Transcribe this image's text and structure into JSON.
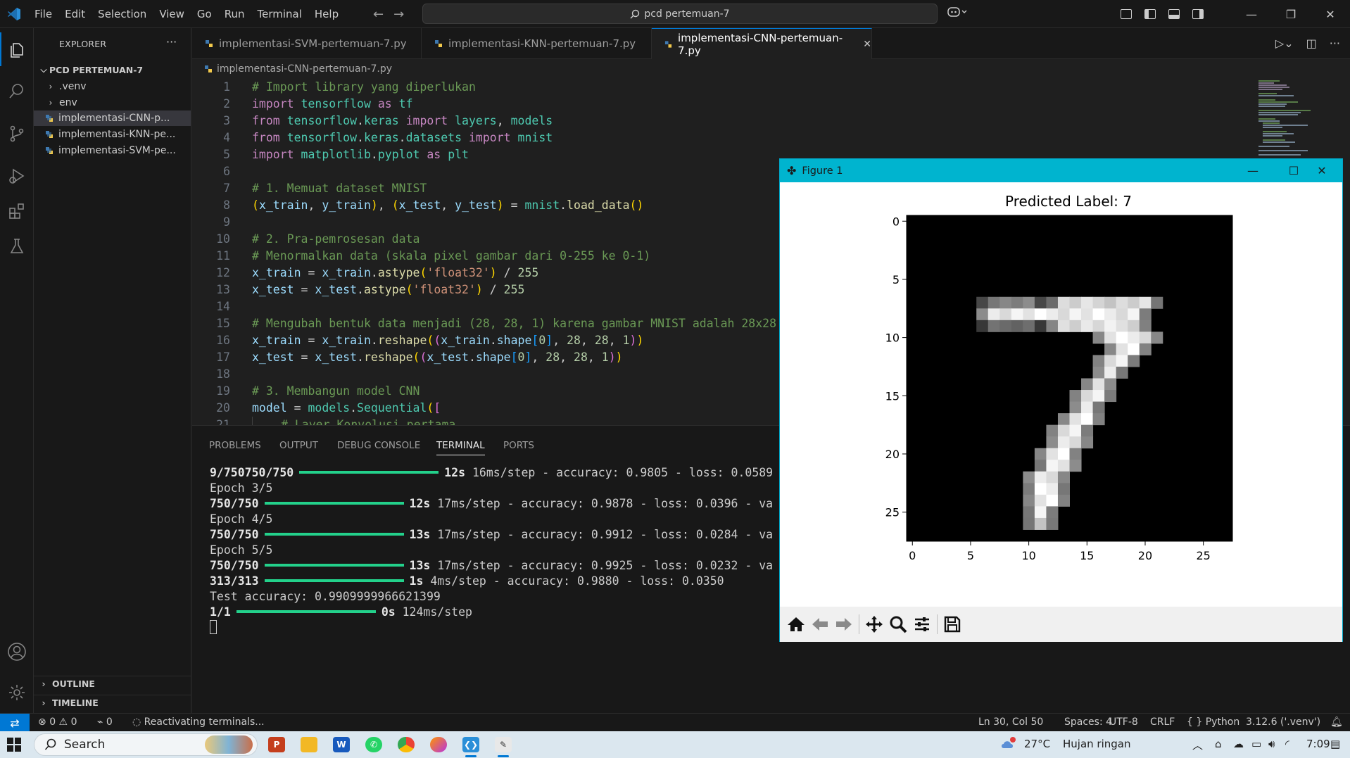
{
  "titlebar": {
    "menu": [
      "File",
      "Edit",
      "Selection",
      "View",
      "Go",
      "Run",
      "Terminal",
      "Help"
    ],
    "search_text": "pcd pertemuan-7"
  },
  "explorer": {
    "header": "EXPLORER",
    "more": "···",
    "root": "PCD PERTEMUAN-7",
    "items": [
      {
        "label": ".venv",
        "kind": "folder"
      },
      {
        "label": "env",
        "kind": "folder"
      },
      {
        "label": "implementasi-CNN-p...",
        "kind": "file",
        "selected": true
      },
      {
        "label": "implementasi-KNN-pe...",
        "kind": "file"
      },
      {
        "label": "implementasi-SVM-pe...",
        "kind": "file"
      }
    ],
    "outline": "OUTLINE",
    "timeline": "TIMELINE"
  },
  "tabs": [
    {
      "label": "implementasi-SVM-pertemuan-7.py"
    },
    {
      "label": "implementasi-KNN-pertemuan-7.py"
    },
    {
      "label": "implementasi-CNN-pertemuan-7.py",
      "active": true
    }
  ],
  "breadcrumb": "implementasi-CNN-pertemuan-7.py",
  "code_lines": [
    "1",
    "2",
    "3",
    "4",
    "5",
    "6",
    "7",
    "8",
    "9",
    "10",
    "11",
    "12",
    "13",
    "14",
    "15",
    "16",
    "17",
    "18",
    "19",
    "20",
    "21"
  ],
  "code": {
    "l1": "# Import library yang diperlukan",
    "l7": "# 1. Memuat dataset MNIST",
    "l10": "# 2. Pra-pemrosesan data",
    "l11": "# Menormalkan data (skala pixel gambar dari 0-255 ke 0-1)",
    "l15": "# Mengubah bentuk data menjadi (28, 28, 1) karena gambar MNIST adalah 28x28",
    "l19": "# 3. Membangun model CNN",
    "l21": "# Layer Konvolusi pertama"
  },
  "panel": {
    "tabs": [
      "PROBLEMS",
      "OUTPUT",
      "DEBUG CONSOLE",
      "TERMINAL",
      "PORTS"
    ],
    "active_tab": "TERMINAL",
    "terminal": {
      "l1_prog": "9/750750/750",
      "l1_rest": "12s",
      "l1_tail": " 16ms/step - accuracy: 0.9805 - loss: 0.0589",
      "epoch3": "Epoch 3/5",
      "l3_prog": "750/750",
      "l3_time": "12s",
      "l3_tail": " 17ms/step - accuracy: 0.9878 - loss: 0.0396 - va",
      "epoch4": "Epoch 4/5",
      "l5_prog": "750/750",
      "l5_time": "13s",
      "l5_tail": " 17ms/step - accuracy: 0.9912 - loss: 0.0284 - va",
      "epoch5": "Epoch 5/5",
      "l7_prog": "750/750",
      "l7_time": "13s",
      "l7_tail": " 17ms/step - accuracy: 0.9925 - loss: 0.0232 - va",
      "l8_prog": "313/313",
      "l8_time": "1s",
      "l8_tail": " 4ms/step - accuracy: 0.9880 - loss: 0.0350",
      "test_acc": "Test accuracy: 0.9909999966621399",
      "l10_prog": "1/1",
      "l10_time": "0s",
      "l10_tail": " 124ms/step"
    }
  },
  "statusbar": {
    "errors": "0",
    "warnings": "0",
    "ports": "0",
    "message": "Reactivating terminals...",
    "position": "Ln 30, Col 50",
    "spaces": "Spaces: 4",
    "encoding": "UTF-8",
    "eol": "CRLF",
    "language": "Python",
    "interpreter": "3.12.6 ('.venv')"
  },
  "taskbar": {
    "search": "Search",
    "weather_temp": "27°C",
    "weather_text": "Hujan ringan",
    "time": "7:09"
  },
  "figure": {
    "window_title": "Figure 1",
    "plot_title": "Predicted Label: 7",
    "yticks": [
      "0",
      "5",
      "10",
      "15",
      "20",
      "25"
    ],
    "xticks": [
      "0",
      "5",
      "10",
      "15",
      "20",
      "25"
    ],
    "toolbar_icons": [
      "home-icon",
      "back-icon",
      "forward-icon",
      "pan-icon",
      "zoom-icon",
      "configure-icon",
      "save-icon"
    ]
  }
}
